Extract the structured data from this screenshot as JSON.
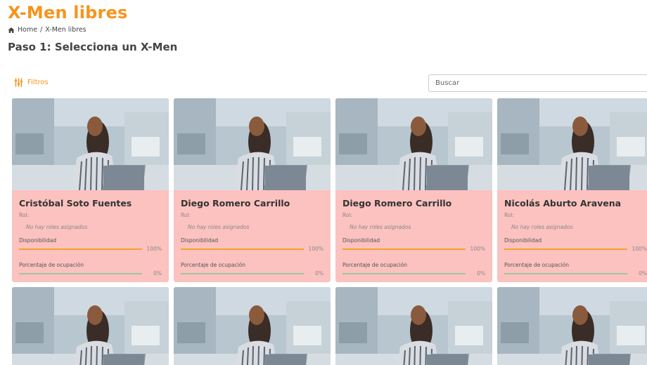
{
  "header": {
    "title": "X-Men libres",
    "breadcrumb": {
      "home": "Home",
      "separator": "/",
      "current": "X-Men libres"
    },
    "step": "Paso 1: Selecciona un X-Men"
  },
  "toolbar": {
    "filters_label": "Filtros",
    "search_placeholder": "Buscar",
    "accent_color": "#f7941d"
  },
  "cards": [
    {
      "name": "Cristóbal Soto Fuentes",
      "rol_label": "Rol:",
      "no_roles": "No hay roles asignados",
      "availability_label": "Disponibilidad",
      "availability": 100,
      "availability_text": "100%",
      "occupancy_label": "Porcentaje de ocupación",
      "occupancy": 0,
      "occupancy_text": "0%"
    },
    {
      "name": "Diego Romero Carrillo",
      "rol_label": "Rol:",
      "no_roles": "No hay roles asignados",
      "availability_label": "Disponibilidad",
      "availability": 100,
      "availability_text": "100%",
      "occupancy_label": "Porcentaje de ocupación",
      "occupancy": 0,
      "occupancy_text": "0%"
    },
    {
      "name": "Diego Romero Carrillo",
      "rol_label": "Rol:",
      "no_roles": "No hay roles asignados",
      "availability_label": "Disponibilidad",
      "availability": 100,
      "availability_text": "100%",
      "occupancy_label": "Porcentaje de ocupación",
      "occupancy": 0,
      "occupancy_text": "0%"
    },
    {
      "name": "Nicolás Aburto Aravena",
      "rol_label": "Rol:",
      "no_roles": "No hay roles asignados",
      "availability_label": "Disponibilidad",
      "availability": 100,
      "availability_text": "100%",
      "occupancy_label": "Porcentaje de ocupación",
      "occupancy": 0,
      "occupancy_text": "0%"
    }
  ],
  "card_color": "#fbc2c0"
}
